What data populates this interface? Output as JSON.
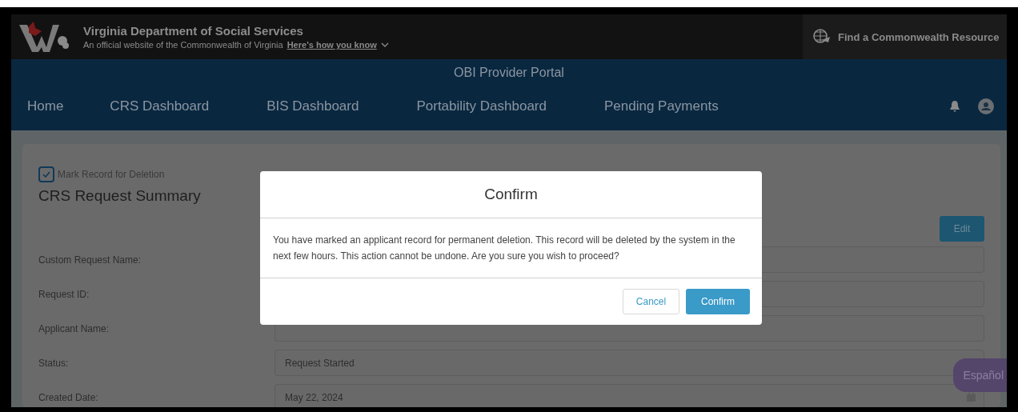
{
  "header": {
    "agency": "Virginia Department of Social Services",
    "tagline": "An official website of the Commonwealth of Virginia",
    "how_link": "Here's how you know",
    "resource_link": "Find a Commonwealth Resource"
  },
  "portal_title": "OBI Provider Portal",
  "nav": [
    {
      "label": "Home"
    },
    {
      "label": "CRS Dashboard"
    },
    {
      "label": "BIS Dashboard"
    },
    {
      "label": "Portability Dashboard"
    },
    {
      "label": "Pending Payments"
    }
  ],
  "mark_for_deletion": {
    "label": "Mark Record for Deletion",
    "checked": true
  },
  "title": "CRS Request Summary",
  "edit_button": "Edit",
  "fields": [
    {
      "label": "Custom Request Name:"
    },
    {
      "label": "Request ID:"
    },
    {
      "label": "Applicant Name:"
    },
    {
      "label": "Status:",
      "value": "Request Started"
    },
    {
      "label": "Created Date:",
      "value": "May 22, 2024",
      "kind": "date"
    }
  ],
  "dialog": {
    "title": "Confirm",
    "message": "You have marked an applicant record for permanent deletion. This record will be deleted by the system in the next few hours. This action cannot be undone. Are you sure you wish to proceed?",
    "buttons": [
      {
        "label": "Cancel",
        "kind": "secondary"
      },
      {
        "label": "Confirm",
        "kind": "primary"
      }
    ]
  },
  "language_button": "Español"
}
